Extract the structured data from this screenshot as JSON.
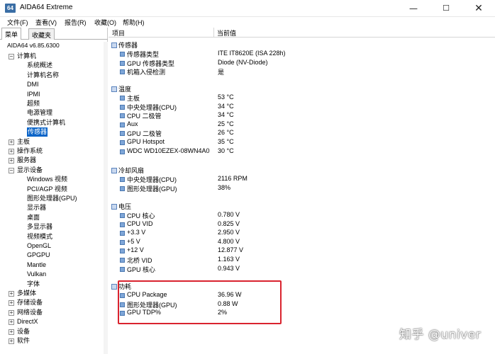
{
  "window": {
    "title": "AIDA64 Extreme",
    "icon_text": "64",
    "minimize": "—",
    "maximize": "☐",
    "close": "✕"
  },
  "menu": [
    "文件(F)",
    "查看(V)",
    "报告(R)",
    "收藏(O)",
    "帮助(H)"
  ],
  "tabs": [
    "菜单",
    "收藏夹"
  ],
  "version": "AIDA64 v6.85.6300",
  "tree": [
    {
      "label": "计算机",
      "expander": "−",
      "level": 0
    },
    {
      "label": "系统概述",
      "level": 1
    },
    {
      "label": "计算机名称",
      "level": 1
    },
    {
      "label": "DMI",
      "level": 1
    },
    {
      "label": "IPMI",
      "level": 1
    },
    {
      "label": "超频",
      "level": 1
    },
    {
      "label": "电源管理",
      "level": 1
    },
    {
      "label": "便携式计算机",
      "level": 1
    },
    {
      "label": "传感器",
      "level": 1,
      "selected": true
    },
    {
      "label": "主板",
      "expander": "+",
      "level": 0
    },
    {
      "label": "操作系统",
      "expander": "+",
      "level": 0
    },
    {
      "label": "服务器",
      "expander": "+",
      "level": 0
    },
    {
      "label": "显示设备",
      "expander": "−",
      "level": 0
    },
    {
      "label": "Windows 视频",
      "level": 1
    },
    {
      "label": "PCI/AGP 视频",
      "level": 1
    },
    {
      "label": "图形处理器(GPU)",
      "level": 1
    },
    {
      "label": "显示器",
      "level": 1
    },
    {
      "label": "桌面",
      "level": 1
    },
    {
      "label": "多显示器",
      "level": 1
    },
    {
      "label": "视频模式",
      "level": 1
    },
    {
      "label": "OpenGL",
      "level": 1
    },
    {
      "label": "GPGPU",
      "level": 1
    },
    {
      "label": "Mantle",
      "level": 1
    },
    {
      "label": "Vulkan",
      "level": 1
    },
    {
      "label": "字体",
      "level": 1
    },
    {
      "label": "多媒体",
      "expander": "+",
      "level": 0
    },
    {
      "label": "存储设备",
      "expander": "+",
      "level": 0
    },
    {
      "label": "网络设备",
      "expander": "+",
      "level": 0
    },
    {
      "label": "DirectX",
      "expander": "+",
      "level": 0
    },
    {
      "label": "设备",
      "expander": "+",
      "level": 0
    },
    {
      "label": "软件",
      "expander": "+",
      "level": 0
    }
  ],
  "columns": {
    "item": "项目",
    "value": "当前值"
  },
  "groups": [
    {
      "title": "传感器",
      "rows": [
        {
          "item": "传感器类型",
          "value": "ITE IT8620E  (ISA 228h)"
        },
        {
          "item": "GPU 传感器类型",
          "value": "Diode  (NV-Diode)"
        },
        {
          "item": "机箱入侵检测",
          "value": "是"
        }
      ]
    },
    {
      "title": "温度",
      "rows": [
        {
          "item": "主板",
          "value": "53 °C"
        },
        {
          "item": "中央处理器(CPU)",
          "value": "34 °C"
        },
        {
          "item": "CPU 二极管",
          "value": "34 °C"
        },
        {
          "item": "Aux",
          "value": "25 °C"
        },
        {
          "item": "GPU 二极管",
          "value": "26 °C"
        },
        {
          "item": "GPU Hotspot",
          "value": "35 °C"
        },
        {
          "item": "WDC WD10EZEX-08WN4A0",
          "value": "30 °C"
        }
      ]
    },
    {
      "title": "冷却风扇",
      "rows": [
        {
          "item": "中央处理器(CPU)",
          "value": "2116 RPM"
        },
        {
          "item": "图形处理器(GPU)",
          "value": "38%"
        }
      ]
    },
    {
      "title": "电压",
      "rows": [
        {
          "item": "CPU 核心",
          "value": "0.780 V"
        },
        {
          "item": "CPU VID",
          "value": "0.825 V"
        },
        {
          "item": "+3.3 V",
          "value": "2.950 V"
        },
        {
          "item": "+5 V",
          "value": "4.800 V"
        },
        {
          "item": "+12 V",
          "value": "12.877 V"
        },
        {
          "item": "北桥 VID",
          "value": "1.163 V"
        },
        {
          "item": "GPU 核心",
          "value": "0.943 V"
        }
      ]
    },
    {
      "title": "功耗",
      "rows": [
        {
          "item": "CPU Package",
          "value": "36.96 W"
        },
        {
          "item": "图形处理器(GPU)",
          "value": "0.88 W"
        },
        {
          "item": "GPU TDP%",
          "value": "2%"
        }
      ]
    }
  ],
  "watermark": "知乎 @univer",
  "colors": {
    "selection": "#0a64c8",
    "highlight_border": "#d9232e"
  }
}
